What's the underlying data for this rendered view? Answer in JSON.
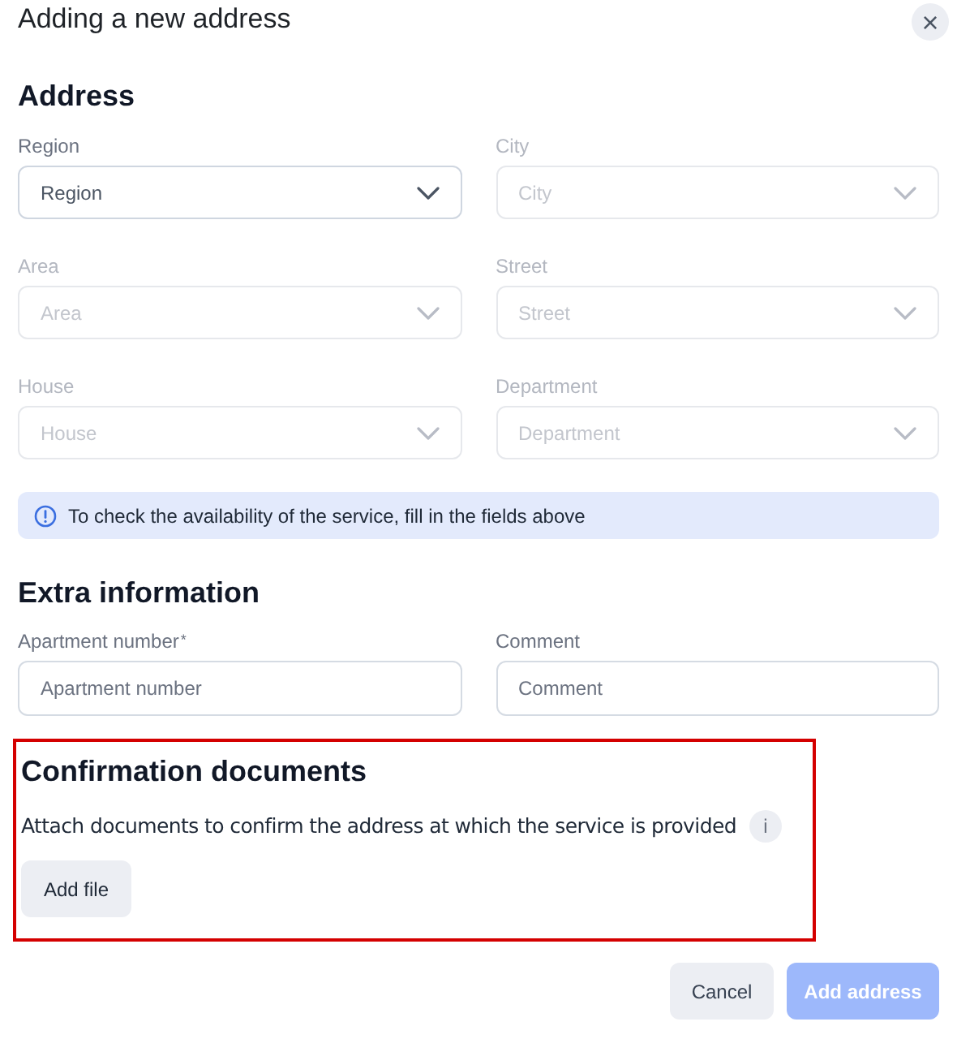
{
  "dialog": {
    "title": "Adding a new address",
    "close_label": "×"
  },
  "address": {
    "heading": "Address",
    "fields": [
      {
        "label": "Region",
        "placeholder": "Region",
        "kind": "select",
        "disabled": false
      },
      {
        "label": "City",
        "placeholder": "City",
        "kind": "select",
        "disabled": true
      },
      {
        "label": "Area",
        "placeholder": "Area",
        "kind": "select",
        "disabled": true
      },
      {
        "label": "Street",
        "placeholder": "Street",
        "kind": "select",
        "disabled": true
      },
      {
        "label": "House",
        "placeholder": "House",
        "kind": "select",
        "disabled": true
      },
      {
        "label": "Department",
        "placeholder": "Department",
        "kind": "select",
        "disabled": true
      }
    ],
    "notice": "To check the availability of the service, fill in the fields above"
  },
  "extra": {
    "heading": "Extra information",
    "fields": [
      {
        "label": "Apartment number",
        "required_mark": "*",
        "placeholder": "Apartment number",
        "kind": "input",
        "disabled": false
      },
      {
        "label": "Comment",
        "placeholder": "Comment",
        "kind": "input",
        "disabled": false
      }
    ]
  },
  "documents": {
    "highlighted": true,
    "heading": "Confirmation documents",
    "description": "Attach documents to confirm the address at which the service is provided",
    "info_label": "i",
    "button": "Add file"
  },
  "footer": {
    "cancel": "Cancel",
    "submit": "Add address",
    "submit_disabled": true
  }
}
